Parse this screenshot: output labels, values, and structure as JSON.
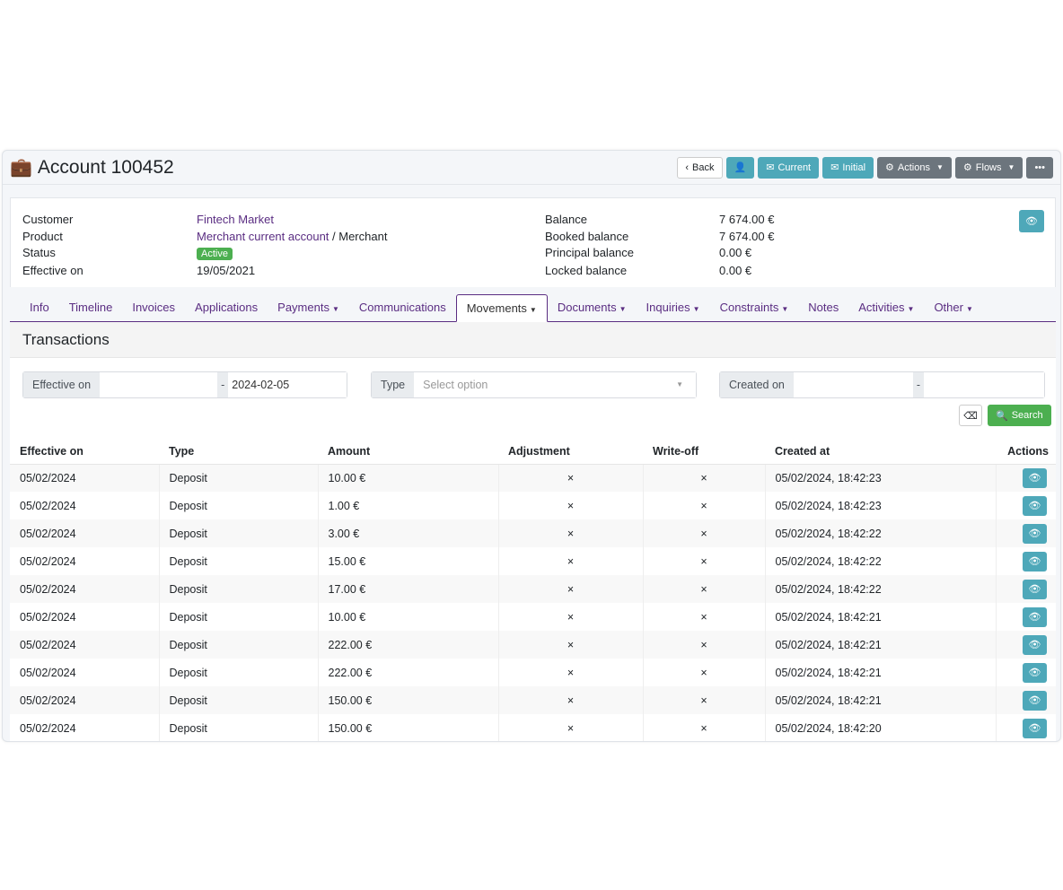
{
  "header": {
    "title": "Account 100452",
    "back": "Back",
    "current": "Current",
    "initial": "Initial",
    "actions": "Actions",
    "flows": "Flows",
    "more": "•••"
  },
  "details": {
    "left": [
      {
        "label": "Customer",
        "value": "Fintech Market"
      },
      {
        "label": "Product",
        "value": "Merchant current account",
        "suffix": " / Merchant"
      },
      {
        "label": "Status",
        "value": "Active"
      },
      {
        "label": "Effective on",
        "value": "19/05/2021"
      }
    ],
    "right": [
      {
        "label": "Balance",
        "value": "7 674.00 €"
      },
      {
        "label": "Booked balance",
        "value": "7 674.00 €"
      },
      {
        "label": "Principal balance",
        "value": "0.00 €"
      },
      {
        "label": "Locked balance",
        "value": "0.00 €"
      }
    ]
  },
  "tabs": [
    {
      "label": "Info"
    },
    {
      "label": "Timeline"
    },
    {
      "label": "Invoices"
    },
    {
      "label": "Applications"
    },
    {
      "label": "Payments",
      "dd": true
    },
    {
      "label": "Communications"
    },
    {
      "label": "Movements",
      "dd": true,
      "active": true
    },
    {
      "label": "Documents",
      "dd": true
    },
    {
      "label": "Inquiries",
      "dd": true
    },
    {
      "label": "Constraints",
      "dd": true
    },
    {
      "label": "Notes"
    },
    {
      "label": "Activities",
      "dd": true
    },
    {
      "label": "Other",
      "dd": true
    }
  ],
  "section_title": "Transactions",
  "filters": {
    "effective_on": "Effective on",
    "effective_to": "2024-02-05",
    "type": "Type",
    "type_placeholder": "Select option",
    "created_on": "Created on",
    "dash": "-",
    "search": "Search"
  },
  "table": {
    "columns": [
      "Effective on",
      "Type",
      "Amount",
      "Adjustment",
      "Write-off",
      "Created at",
      "Actions"
    ],
    "rows": [
      [
        "05/02/2024",
        "Deposit",
        "10.00 €",
        "×",
        "×",
        "05/02/2024, 18:42:23"
      ],
      [
        "05/02/2024",
        "Deposit",
        "1.00 €",
        "×",
        "×",
        "05/02/2024, 18:42:23"
      ],
      [
        "05/02/2024",
        "Deposit",
        "3.00 €",
        "×",
        "×",
        "05/02/2024, 18:42:22"
      ],
      [
        "05/02/2024",
        "Deposit",
        "15.00 €",
        "×",
        "×",
        "05/02/2024, 18:42:22"
      ],
      [
        "05/02/2024",
        "Deposit",
        "17.00 €",
        "×",
        "×",
        "05/02/2024, 18:42:22"
      ],
      [
        "05/02/2024",
        "Deposit",
        "10.00 €",
        "×",
        "×",
        "05/02/2024, 18:42:21"
      ],
      [
        "05/02/2024",
        "Deposit",
        "222.00 €",
        "×",
        "×",
        "05/02/2024, 18:42:21"
      ],
      [
        "05/02/2024",
        "Deposit",
        "222.00 €",
        "×",
        "×",
        "05/02/2024, 18:42:21"
      ],
      [
        "05/02/2024",
        "Deposit",
        "150.00 €",
        "×",
        "×",
        "05/02/2024, 18:42:21"
      ],
      [
        "05/02/2024",
        "Deposit",
        "150.00 €",
        "×",
        "×",
        "05/02/2024, 18:42:20"
      ]
    ]
  },
  "colors": {
    "accent": "#5a2d82",
    "info": "#4ea8b9",
    "secondary": "#6c757d",
    "success": "#4caf50"
  }
}
